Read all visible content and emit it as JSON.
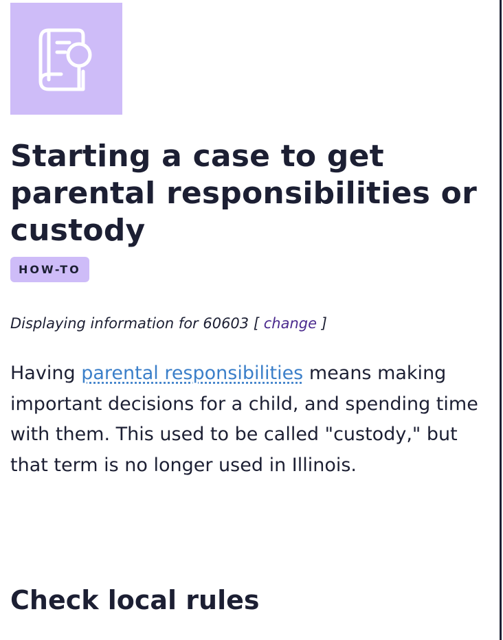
{
  "hero": {
    "icon": "book-search-icon",
    "icon_bg_color": "#cebcf8"
  },
  "article": {
    "title": "Starting a case to get parental responsibilities or custody",
    "badge": "HOW-TO"
  },
  "location": {
    "prefix": "Displaying information for 60603 [",
    "change_label": "change",
    "suffix": "]"
  },
  "intro": {
    "lead": "Having",
    "term_link": "parental responsibilities",
    "rest": "means making important decisions for a child, and spending time with them. This used to be called \"custody,\" but that term is no longer used in Illinois."
  },
  "sections": {
    "check_local_rules": "Check local rules"
  },
  "colors": {
    "text": "#1c1f33",
    "link": "#3b7fc9",
    "change_link": "#4b2a8e",
    "accent": "#cebcf8"
  }
}
